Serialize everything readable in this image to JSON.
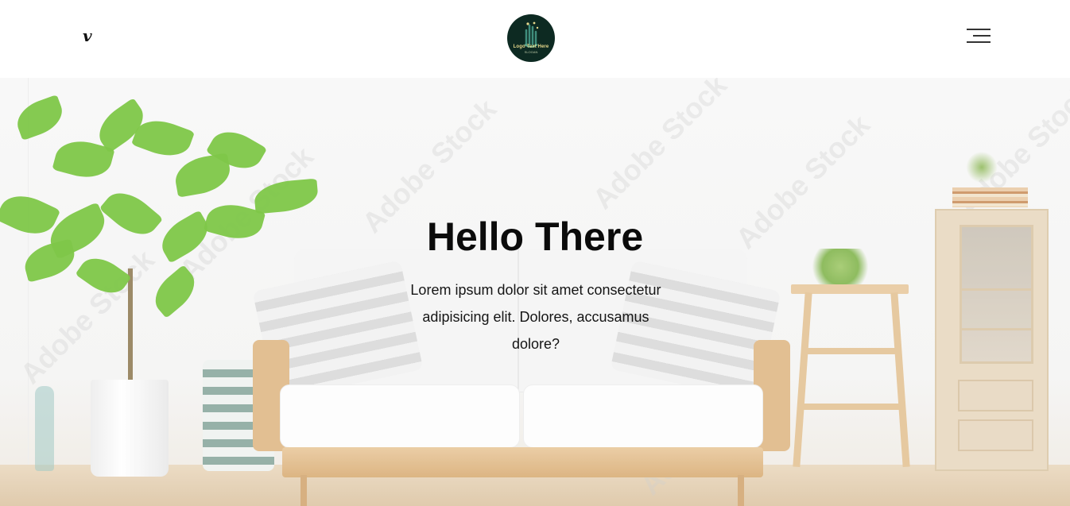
{
  "header": {
    "social_icon": "vimeo-icon",
    "social_glyph": "v",
    "logo": {
      "text": "Logo Text Here",
      "slogan": "SLOGAN"
    },
    "menu_icon": "hamburger-menu-icon"
  },
  "hero": {
    "title": "Hello There",
    "text": "Lorem ipsum dolor sit amet consectetur adipisicing elit. Dolores, accusamus dolore?",
    "watermark": "Adobe Stock"
  },
  "colors": {
    "logo_bg": "#0d2a22",
    "logo_accent": "#e7d88b",
    "title": "#0b0b0b",
    "background": "#ffffff"
  }
}
